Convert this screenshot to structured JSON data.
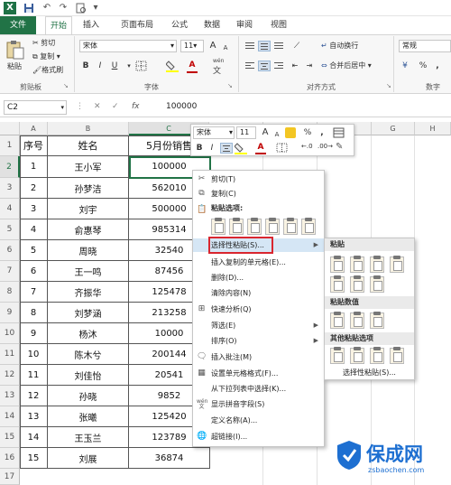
{
  "quick_access": {
    "logo": "X",
    "save": "💾",
    "undo": "↶",
    "redo": "↷",
    "print_preview": "🔍"
  },
  "tabs": [
    "文件",
    "开始",
    "插入",
    "页面布局",
    "公式",
    "数据",
    "审阅",
    "视图"
  ],
  "ribbon": {
    "clipboard": {
      "label": "剪贴板",
      "paste": "粘贴",
      "cut": "剪切",
      "copy": "复制",
      "format_painter": "格式刷"
    },
    "font": {
      "label": "字体",
      "name": "宋体",
      "size": "11",
      "grow": "A",
      "shrink": "A",
      "bold": "B",
      "italic": "I",
      "underline": "U",
      "wen": "wén",
      "font_color": "A"
    },
    "alignment": {
      "label": "对齐方式",
      "wrap": "自动换行",
      "merge": "合并后居中"
    },
    "number": {
      "label": "数字",
      "format": "常规",
      "currency": "¥",
      "percent": "%",
      "comma": ","
    }
  },
  "formula_bar": {
    "name_box": "C2",
    "fx": "fx",
    "cancel": "✕",
    "enter": "✓",
    "value": "100000"
  },
  "grid": {
    "columns": [
      "A",
      "B",
      "C",
      "D",
      "E",
      "F",
      "G",
      "H"
    ],
    "rows": [
      "1",
      "2",
      "3",
      "4",
      "5",
      "6",
      "7",
      "8",
      "9",
      "10",
      "11",
      "12",
      "13",
      "14",
      "15",
      "16"
    ],
    "headers": [
      "序号",
      "姓名",
      "5月份销售"
    ],
    "data": [
      [
        "1",
        "王小军",
        "100000"
      ],
      [
        "2",
        "孙梦洁",
        "562010"
      ],
      [
        "3",
        "刘宇",
        "500000"
      ],
      [
        "4",
        "俞惠琴",
        "985314"
      ],
      [
        "5",
        "周晓",
        "32540"
      ],
      [
        "6",
        "王一鸣",
        "87456"
      ],
      [
        "7",
        "齐振华",
        "125478"
      ],
      [
        "8",
        "刘梦涵",
        "213258"
      ],
      [
        "9",
        "杨沐",
        "10000"
      ],
      [
        "10",
        "陈木兮",
        "200144"
      ],
      [
        "11",
        "刘佳怡",
        "20541"
      ],
      [
        "12",
        "孙晓",
        "9852"
      ],
      [
        "13",
        "张曦",
        "125420"
      ],
      [
        "14",
        "王玉兰",
        "123789"
      ],
      [
        "15",
        "刘展",
        "36874"
      ]
    ]
  },
  "mini_toolbar": {
    "font": "宋体",
    "size": "11",
    "bold": "B",
    "italic": "I",
    "font_color": "A",
    "percent": "%",
    "comma": ","
  },
  "context_menu": {
    "cut": "剪切(T)",
    "copy": "复制(C)",
    "paste_options": "粘贴选项:",
    "paste_special": "选择性粘贴(S)...",
    "insert_copied": "插入复制的单元格(E)...",
    "delete": "删除(D)...",
    "clear": "清除内容(N)",
    "quick_analysis": "快速分析(Q)",
    "filter": "筛选(E)",
    "sort": "排序(O)",
    "insert_comment": "插入批注(M)",
    "format_cells": "设置单元格格式(F)...",
    "pick_list": "从下拉列表中选择(K)...",
    "phonetic": "显示拼音字段(S)",
    "define_name": "定义名称(A)...",
    "hyperlink": "超链接(I)..."
  },
  "submenu": {
    "paste": "粘贴",
    "paste_values": "粘贴数值",
    "other_paste": "其他粘贴选项",
    "paste_special": "选择性粘贴(S)..."
  },
  "watermark": {
    "brand": "保成网",
    "url": "zsbaochen.com"
  },
  "colors": {
    "excel_green": "#217346",
    "highlight": "#d5e6f5",
    "red_box": "#d9262f",
    "watermark_blue": "#1d6fd1"
  }
}
